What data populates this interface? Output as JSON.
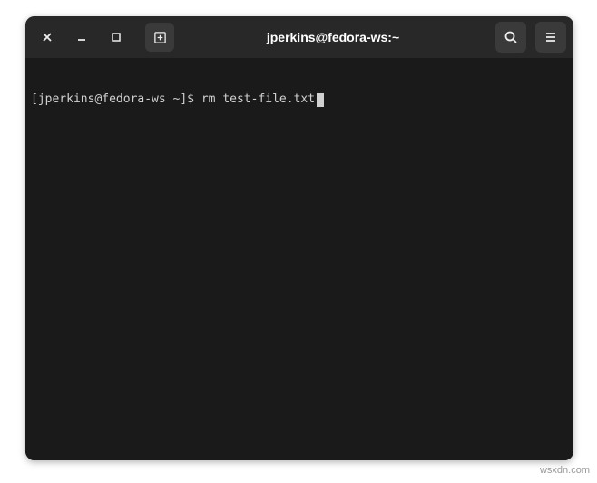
{
  "window": {
    "title": "jperkins@fedora-ws:~"
  },
  "terminal": {
    "prompt": "[jperkins@fedora-ws ~]$ ",
    "command": "rm test-file.txt"
  },
  "watermark": "wsxdn.com"
}
